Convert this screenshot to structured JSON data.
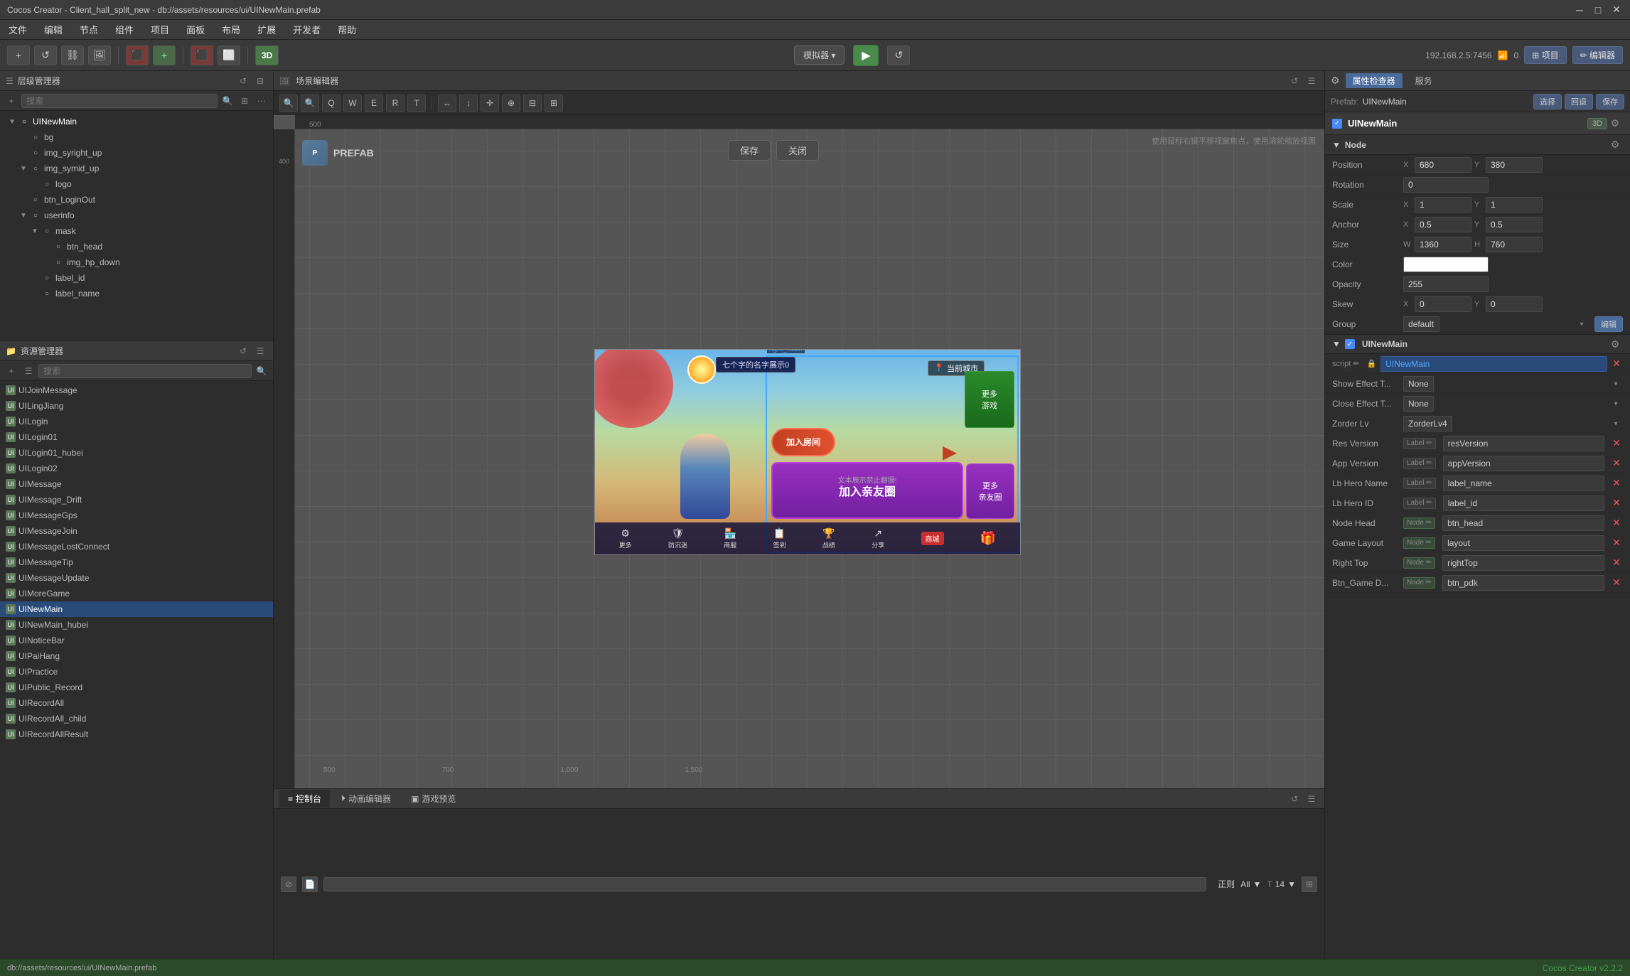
{
  "titleBar": {
    "title": "Cocos Creator - Client_hall_split_new - db://assets/resources/ui/UINewMain.prefab",
    "minimize": "─",
    "maximize": "□",
    "close": "✕"
  },
  "menuBar": {
    "items": [
      "文件",
      "编辑",
      "节点",
      "组件",
      "项目",
      "面板",
      "布局",
      "扩展",
      "开发者",
      "帮助"
    ]
  },
  "toolbar": {
    "simulatorLabel": "模拟器 ▾",
    "playIcon": "▶",
    "ipAddress": "192.168.2.5:7456",
    "wifiIcon": "📶",
    "networkNum": "0",
    "projectBtn": "⊞ 项目",
    "editorBtn": "✏ 编辑器",
    "refreshIcon": "↺",
    "addIcon": "+",
    "btn3d": "3D"
  },
  "hierarchyPanel": {
    "title": "层级管理器",
    "searchPlaceholder": "搜索",
    "treeItems": [
      {
        "id": "uinewmain",
        "label": "UINewMain",
        "indent": 0,
        "expanded": true,
        "active": true
      },
      {
        "id": "bg",
        "label": "bg",
        "indent": 1,
        "expanded": false
      },
      {
        "id": "img_syright_up",
        "label": "img_syright_up",
        "indent": 1,
        "expanded": false
      },
      {
        "id": "img_symid_up",
        "label": "img_symid_up",
        "indent": 1,
        "expanded": true
      },
      {
        "id": "logo",
        "label": "logo",
        "indent": 2,
        "expanded": false
      },
      {
        "id": "btn_loginout",
        "label": "btn_LoginOut",
        "indent": 1,
        "expanded": false
      },
      {
        "id": "userinfo",
        "label": "userinfo",
        "indent": 1,
        "expanded": true
      },
      {
        "id": "mask",
        "label": "mask",
        "indent": 2,
        "expanded": true
      },
      {
        "id": "btn_head",
        "label": "btn_head",
        "indent": 3,
        "expanded": false
      },
      {
        "id": "img_hp_down",
        "label": "img_hp_down",
        "indent": 3,
        "expanded": false
      },
      {
        "id": "label_id",
        "label": "label_id",
        "indent": 2,
        "expanded": false
      },
      {
        "id": "label_name",
        "label": "label_name",
        "indent": 2,
        "expanded": false
      }
    ]
  },
  "assetsPanel": {
    "title": "资源管理器",
    "searchPlaceholder": "搜索",
    "items": [
      "UIJoinMessage",
      "UILingJiang",
      "UILogin",
      "UILogin01",
      "UILogin01_hubei",
      "UILogin02",
      "UIMessage",
      "UIMessage_Drift",
      "UIMessageGps",
      "UIMessageJoin",
      "UIMessageLostConnect",
      "UIMessageTip",
      "UIMessageUpdate",
      "UIMoreGame",
      "UINewMain",
      "UINewMain_hubei",
      "UINoticeBar",
      "UIPaiHang",
      "UIPractice",
      "UIPublic_Record",
      "UIRecordAll",
      "UIRecordAll_child",
      "UIRecordAllResult"
    ],
    "selectedItem": "UINewMain"
  },
  "sceneEditor": {
    "title": "场景编辑器",
    "hint": "使用鼠标右键平移视窗焦点，使用滚轮缩放视图",
    "prefabLabel": "PREFAB",
    "saveBtn": "保存",
    "closeBtn": "关闭",
    "selectionLabel": "right_main",
    "rulerValues": {
      "left": "500",
      "top": "400",
      "bottom500": "500",
      "bottom1000": "1,000",
      "bottom1500": "1,500"
    }
  },
  "bottomPanel": {
    "tabs": [
      {
        "id": "console",
        "label": "控制台",
        "icon": "≡"
      },
      {
        "id": "animation",
        "label": "动画编辑器",
        "icon": "⏵"
      },
      {
        "id": "gamepreview",
        "label": "游戏预览",
        "icon": "▣"
      }
    ],
    "activeTab": "console",
    "consoleOptions": {
      "mode": "正则",
      "filter": "All",
      "fontSize": "14"
    }
  },
  "rightPanel": {
    "tabs": [
      "属性检查器",
      "服务"
    ],
    "activeTab": "属性检查器",
    "prefabInfo": "Prefab:  UINewMain",
    "prefabBtns": [
      "选择",
      "回退",
      "保存"
    ],
    "componentName": "UINewMain",
    "badge3d": "3D",
    "nodeSection": {
      "title": "Node",
      "properties": [
        {
          "label": "Position",
          "x": "680",
          "y": "380"
        },
        {
          "label": "Rotation",
          "value": "0"
        },
        {
          "label": "Scale",
          "x": "1",
          "y": "1"
        },
        {
          "label": "Anchor",
          "x": "0.5",
          "y": "0.5"
        },
        {
          "label": "Size",
          "w": "1360",
          "h": "760"
        },
        {
          "label": "Color",
          "isColor": true,
          "colorValue": "#ffffff"
        },
        {
          "label": "Opacity",
          "value": "255"
        },
        {
          "label": "Skew",
          "x": "0",
          "y": "0"
        },
        {
          "label": "Group",
          "value": "default"
        }
      ]
    },
    "uiNewMainSection": {
      "title": "UINewMain",
      "scriptLabel": "script ✏",
      "scriptValue": "UINewMain",
      "properties": [
        {
          "label": "Show Effect T...",
          "value": "None",
          "isSelect": true
        },
        {
          "label": "Close Effect T...",
          "value": "None",
          "isSelect": true
        },
        {
          "label": "Zorder Lv",
          "value": "ZorderLv4",
          "isSelect": true
        },
        {
          "label": "Res Version",
          "refType": "Label",
          "value": "resVersion"
        },
        {
          "label": "App Version",
          "refType": "Label",
          "value": "appVersion"
        },
        {
          "label": "Lb Hero Name",
          "refType": "Label",
          "value": "label_name"
        },
        {
          "label": "Lb Hero ID",
          "refType": "Label",
          "value": "label_id"
        },
        {
          "label": "Node Head",
          "refType": "Node",
          "value": "btn_head"
        },
        {
          "label": "Game Layout",
          "refType": "Node",
          "value": "layout"
        },
        {
          "label": "Right Top",
          "refType": "Node",
          "value": "rightTop"
        },
        {
          "label": "Btn_Game D...",
          "refType": "Node",
          "value": "btn_pdk"
        }
      ]
    }
  },
  "statusBar": {
    "path": "db://assets/resources/ui/UINewMain.prefab",
    "version": "Cocos Creator v2.2.2"
  }
}
